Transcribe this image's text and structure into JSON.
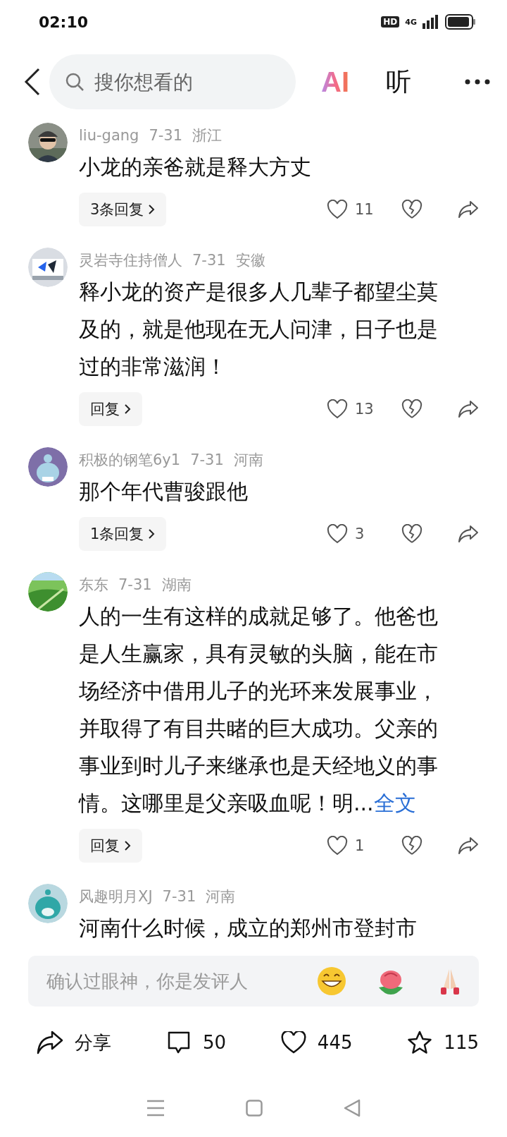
{
  "status_bar": {
    "time": "02:10",
    "hd": "HD",
    "network": "4G"
  },
  "header": {
    "search_placeholder": "搜你想看的",
    "ai": "AI",
    "listen": "听"
  },
  "comments": [
    {
      "user": "liu-gang",
      "date": "7-31",
      "region": "浙江",
      "text": "小龙的亲爸就是释大方丈",
      "replies": "3条回复",
      "likes": "11"
    },
    {
      "user": "灵岩寺住持僧人",
      "date": "7-31",
      "region": "安徽",
      "text": "释小龙的资产是很多人几辈子都望尘莫及的，就是他现在无人问津，日子也是过的非常滋润！",
      "replies": "回复",
      "likes": "13"
    },
    {
      "user": "积极的钢笔6y1",
      "date": "7-31",
      "region": "河南",
      "text": "那个年代曹骏跟他",
      "replies": "1条回复",
      "likes": "3"
    },
    {
      "user": "东东",
      "date": "7-31",
      "region": "湖南",
      "text": "人的一生有这样的成就足够了。他爸也是人生赢家，具有灵敏的头脑，能在市场经济中借用儿子的光环来发展事业，并取得了有目共睹的巨大成功。父亲的事业到时儿子来继承也是天经地义的事情。这哪里是父亲吸血呢！明...",
      "more": "全文",
      "replies": "回复",
      "likes": "1"
    },
    {
      "user": "风趣明月XJ",
      "date": "7-31",
      "region": "河南",
      "text": "河南什么时候，成立的郑州市登封市"
    }
  ],
  "comment_input": {
    "placeholder": "确认过眼神，你是发评人"
  },
  "actions": {
    "share": "分享",
    "comments": "50",
    "likes": "445",
    "favorites": "115"
  }
}
